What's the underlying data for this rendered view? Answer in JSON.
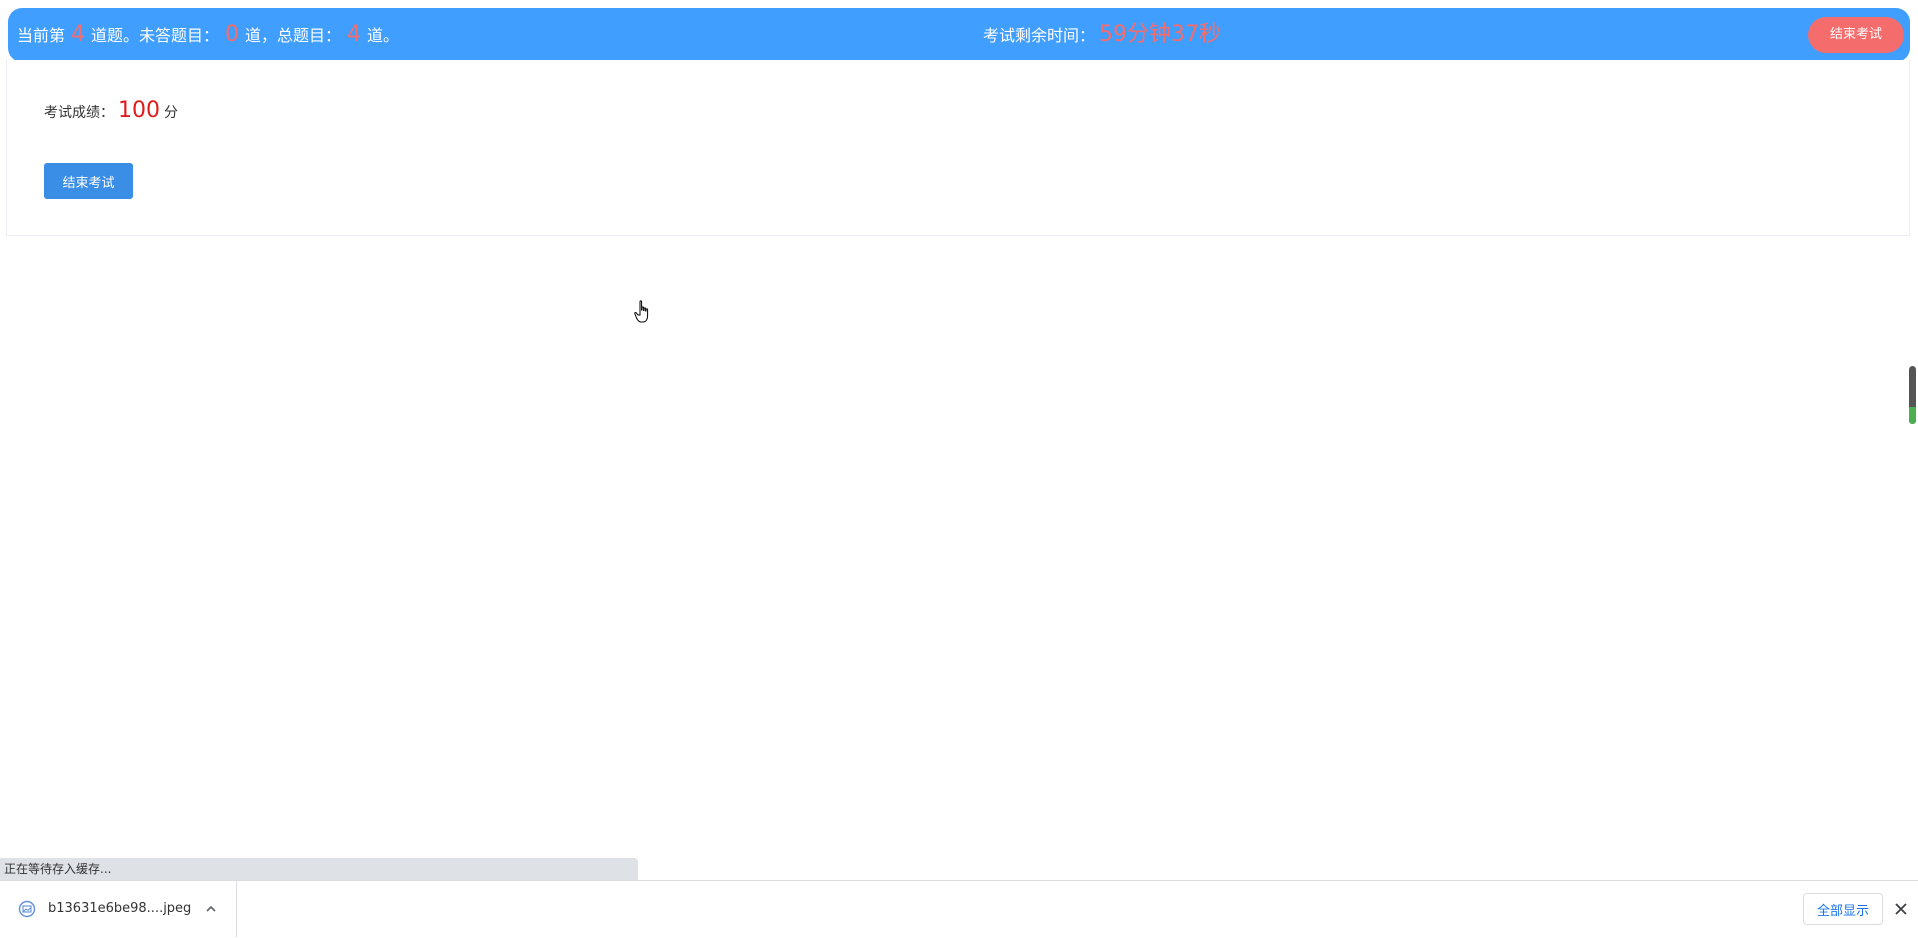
{
  "topbar": {
    "current_prefix": "当前第",
    "current_num": "4",
    "current_suffix": "道题。未答题目：",
    "unanswered_num": "0",
    "unanswered_suffix": "道，总题目：",
    "total_num": "4",
    "total_suffix": "道。",
    "timer_label": "考试剩余时间：",
    "timer_value": "59分钟37秒",
    "end_button_label": "结束考试",
    "bg_color": "#409eff",
    "accent_color": "#f56c6c"
  },
  "result": {
    "score_label": "考试成绩：",
    "score_value": "100",
    "score_unit": "分",
    "end_button_label": "结束考试"
  },
  "scrollbar": {
    "position_fraction": 0.3
  },
  "status": {
    "text": "正在等待存入缓存..."
  },
  "downloads": {
    "file_name": "b13631e6be98....jpeg",
    "show_all_label": "全部显示",
    "file_icon": "image-file-icon",
    "expand_icon": "chevron-up-icon",
    "close_icon": "close-icon"
  }
}
